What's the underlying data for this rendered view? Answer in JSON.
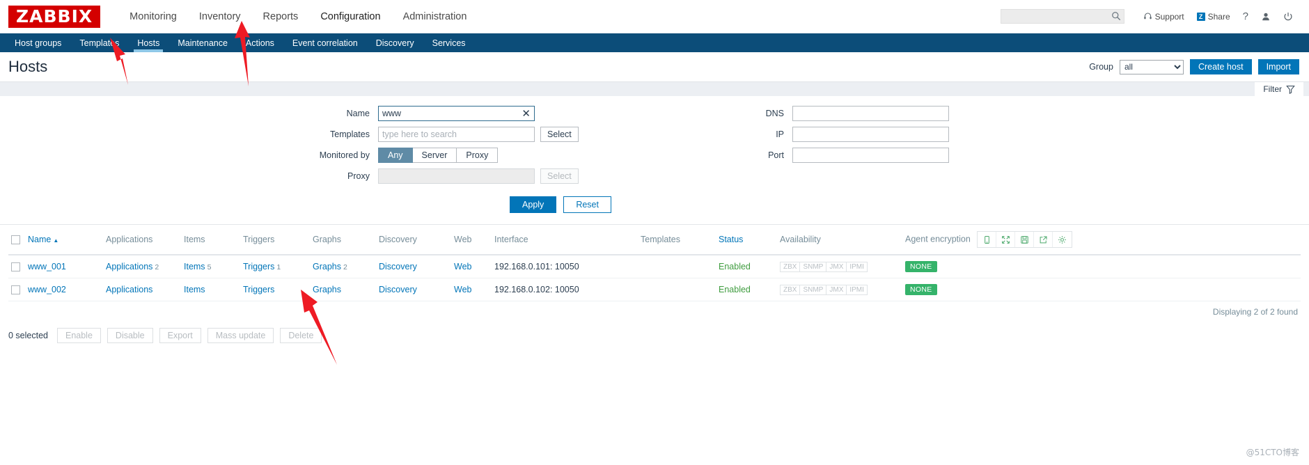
{
  "header": {
    "logo": "ZABBIX",
    "nav": [
      {
        "label": "Monitoring",
        "active": false
      },
      {
        "label": "Inventory",
        "active": false
      },
      {
        "label": "Reports",
        "active": false
      },
      {
        "label": "Configuration",
        "active": true
      },
      {
        "label": "Administration",
        "active": false
      }
    ],
    "search": {
      "value": "",
      "placeholder": ""
    },
    "support_label": "Support",
    "share_label": "Share",
    "share_badge": "Z",
    "help_label": "?"
  },
  "subnav": [
    {
      "label": "Host groups",
      "active": false
    },
    {
      "label": "Templates",
      "active": false
    },
    {
      "label": "Hosts",
      "active": true
    },
    {
      "label": "Maintenance",
      "active": false
    },
    {
      "label": "Actions",
      "active": false
    },
    {
      "label": "Event correlation",
      "active": false
    },
    {
      "label": "Discovery",
      "active": false
    },
    {
      "label": "Services",
      "active": false
    }
  ],
  "title": {
    "page_title": "Hosts",
    "group_label": "Group",
    "group_value": "all",
    "create_host_label": "Create host",
    "import_label": "Import"
  },
  "filter_tab": {
    "label": "Filter"
  },
  "filter": {
    "name_label": "Name",
    "name_value": "www",
    "templates_label": "Templates",
    "templates_value": "",
    "templates_placeholder": "type here to search",
    "templates_select_label": "Select",
    "monitored_by_label": "Monitored by",
    "monitored_by_options": [
      "Any",
      "Server",
      "Proxy"
    ],
    "monitored_by_selected": "Any",
    "proxy_label": "Proxy",
    "proxy_value": "",
    "proxy_select_label": "Select",
    "dns_label": "DNS",
    "dns_value": "",
    "ip_label": "IP",
    "ip_value": "",
    "port_label": "Port",
    "port_value": "",
    "apply_label": "Apply",
    "reset_label": "Reset"
  },
  "table": {
    "columns": [
      "Name",
      "Applications",
      "Items",
      "Triggers",
      "Graphs",
      "Discovery",
      "Web",
      "Interface",
      "Templates",
      "Status",
      "Availability",
      "Agent encryption"
    ],
    "sort_indicator": "▲",
    "header_icons": [
      "mobile-icon",
      "expand-icon",
      "save-icon",
      "external-link-icon",
      "gear-icon"
    ],
    "availability_labels": [
      "ZBX",
      "SNMP",
      "JMX",
      "IPMI"
    ],
    "rows": [
      {
        "name": "www_001",
        "applications": "Applications",
        "applications_count": "2",
        "items": "Items",
        "items_count": "5",
        "triggers": "Triggers",
        "triggers_count": "1",
        "graphs": "Graphs",
        "graphs_count": "2",
        "discovery": "Discovery",
        "web": "Web",
        "interface": "192.168.0.101: 10050",
        "templates": "",
        "status": "Enabled",
        "encryption": "NONE"
      },
      {
        "name": "www_002",
        "applications": "Applications",
        "applications_count": "",
        "items": "Items",
        "items_count": "",
        "triggers": "Triggers",
        "triggers_count": "",
        "graphs": "Graphs",
        "graphs_count": "",
        "discovery": "Discovery",
        "web": "Web",
        "interface": "192.168.0.102: 10050",
        "templates": "",
        "status": "Enabled",
        "encryption": "NONE"
      }
    ],
    "found_text": "Displaying 2 of 2 found"
  },
  "footer": {
    "selected_text": "0 selected",
    "buttons": [
      "Enable",
      "Disable",
      "Export",
      "Mass update",
      "Delete"
    ]
  },
  "watermark": "@51CTO博客",
  "colors": {
    "brand_red": "#d40000",
    "nav_blue": "#0c4d79",
    "accent_blue": "#0275b8",
    "green": "#3f9c3f",
    "badge_green": "#35b36a",
    "annotation_red": "#ee1b24"
  }
}
